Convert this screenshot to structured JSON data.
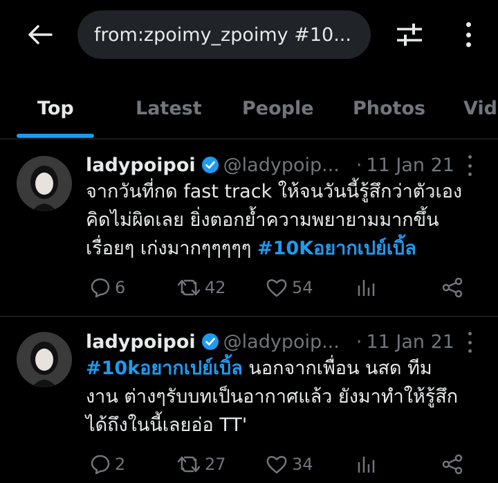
{
  "search": {
    "query": "from:zpoimy_zpoimy #10..."
  },
  "icons": {
    "back": "arrow-left-icon",
    "filter": "sliders-icon",
    "more": "more-vertical-icon"
  },
  "tabs": [
    {
      "label": "Top",
      "active": true
    },
    {
      "label": "Latest",
      "active": false
    },
    {
      "label": "People",
      "active": false
    },
    {
      "label": "Photos",
      "active": false
    },
    {
      "label": "Vid",
      "active": false
    }
  ],
  "colors": {
    "accent": "#1d9bf0",
    "background": "#000000",
    "muted": "#71767b",
    "text": "#e7e9ea"
  },
  "tweets": [
    {
      "name": "ladypoipoi",
      "handle": "@ladypoip...",
      "dot": "·",
      "date": "11 Jan 21",
      "lines": [
        {
          "text": "จากวันที่กด fast track ให้จนวันนี้รู้สึกว่าตัวเอง",
          "tag": ""
        },
        {
          "text": "คิดไม่ผิดเลย ยิ่งตอกย้ำความพยายามมากขึ้น",
          "tag": ""
        },
        {
          "text": "เรื่อยๆ เก่งมากๆๆๆๆๆ ",
          "tag": "#10Kอยากเปย์เบิ้ล"
        }
      ],
      "replies": "6",
      "retweets": "42",
      "likes": "54"
    },
    {
      "name": "ladypoipoi",
      "handle": "@ladypoip...",
      "dot": "·",
      "date": "11 Jan 21",
      "lines": [
        {
          "tag": "#10kอยากเปย์เบิ้ล",
          "text": " นอกจากเพื่อน นสด ทีม"
        },
        {
          "text": "งาน ต่างๆรับบทเป็นอากาศแล้ว ยังมาทำให้รู้สึก",
          "tag": ""
        },
        {
          "text": "ได้ถึงในนี้เลยอ่อ TT'",
          "tag": ""
        }
      ],
      "replies": "2",
      "retweets": "27",
      "likes": "34"
    }
  ]
}
